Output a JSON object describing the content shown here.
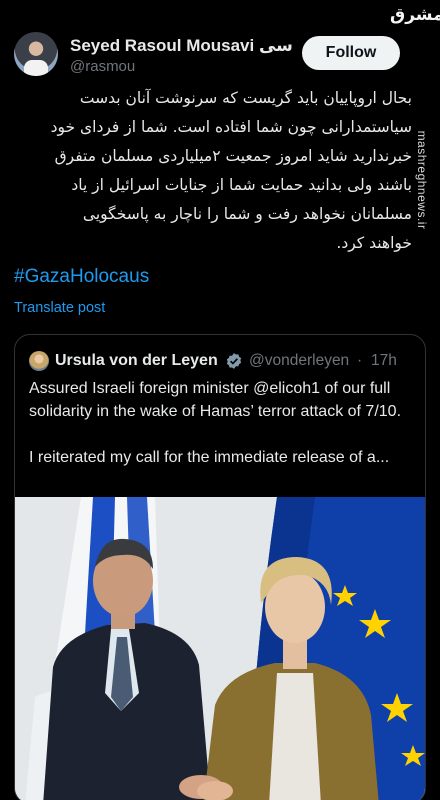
{
  "post": {
    "author_name": "Seyed Rasoul Mousavi سی",
    "author_handle": "@rasmou",
    "follow_label": "Follow",
    "text_lines": [
      "بحال اروپاییان باید گریست که سرنوشت آنان بدست",
      "سیاستمدارانی چون شما افتاده است. شما از فردای خود",
      "خبرندارید شاید امروز جمعیت ۲میلیاردی مسلمان متفرق",
      "باشند ولی بدانید حمایت شما از جنایات اسرائیل از یاد",
      "مسلمانان نخواهد رفت و شما را ناچار به پاسخگویی",
      "خواهند کرد."
    ],
    "hashtag": "#GazaHolocaus",
    "translate_label": "Translate post"
  },
  "quote": {
    "author_name": "Ursula von der Leyen",
    "author_handle": "@vonderleyen",
    "separator": "·",
    "time": "17h",
    "text_1": "Assured Israeli foreign minister @elicoh1 of our full solidarity in the wake of Hamas’ terror attack of 7/10.",
    "text_2": "I reiterated my call for the immediate release of a..."
  },
  "watermark": {
    "logo_text": "مشرق",
    "url": "mashreghnews.ir"
  },
  "colors": {
    "background": "#000000",
    "text": "#e7e9ea",
    "secondary": "#71767b",
    "link": "#1d9bf0",
    "border": "#2f3336",
    "eu_blue": "#0f3fa8",
    "eu_star": "#ffd200",
    "israel_blue": "#1c4fc4"
  }
}
